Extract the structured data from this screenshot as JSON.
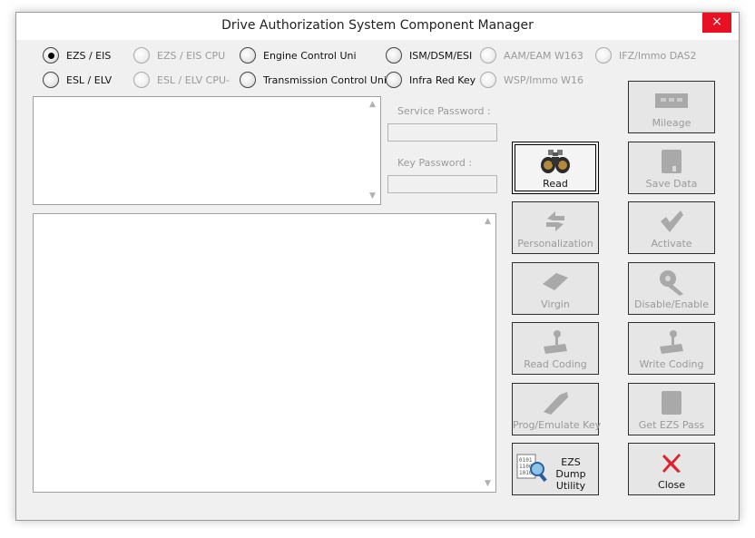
{
  "window": {
    "title": "Drive Authorization System Component Manager",
    "close_glyph": "×"
  },
  "radios": {
    "ezs_eis": "EZS / EIS",
    "ezs_eis_cpu": "EZS / EIS CPU",
    "engine_control": "Engine Control Uni",
    "ism_dsm_esi": "ISM/DSM/ESI",
    "aam_eam": "AAM/EAM W163",
    "ifz_immo": "IFZ/Immo DAS2",
    "esl_elv": "ESL / ELV",
    "esl_elv_cpu": "ESL / ELV CPU-",
    "transmission_control": "Transmission Control Uni",
    "infra_red_key": "Infra Red Key",
    "wsp_immo": "WSP/Immo W16"
  },
  "fields": {
    "service_password_label": "Service Password :",
    "service_password_value": "",
    "key_password_label": "Key Password :",
    "key_password_value": ""
  },
  "buttons": {
    "mileage": "Mileage",
    "read": "Read",
    "save_data": "Save Data",
    "personalization": "Personalization",
    "activate": "Activate",
    "virgin": "Virgin",
    "disable_enable": "Disable/Enable",
    "read_coding": "Read Coding",
    "write_coding": "Write Coding",
    "prog_emulate_key": "Prog/Emulate Key",
    "get_ezs_pass": "Get EZS Pass",
    "ezs_dump_utility": "EZS Dump Utility",
    "close": "Close"
  },
  "scroll": {
    "up": "▲",
    "down": "▼"
  },
  "icons": {
    "mileage": "odometer-icon",
    "read": "binoculars-icon",
    "save_data": "floppy-disk-icon",
    "personalization": "refresh-arrows-icon",
    "activate": "checkmark-icon",
    "virgin": "eraser-icon",
    "disable_enable": "key-icon",
    "read_coding": "joystick-icon",
    "write_coding": "joystick-icon",
    "prog_emulate_key": "car-key-icon",
    "get_ezs_pass": "disk-card-icon",
    "ezs_dump_utility": "binary-magnifier-icon",
    "close": "red-x-icon"
  },
  "colors": {
    "close_button": "#e81123",
    "close_icon": "#e0222f",
    "disabled_text": "#9a9a9a",
    "window_bg": "#f0f0f0"
  }
}
